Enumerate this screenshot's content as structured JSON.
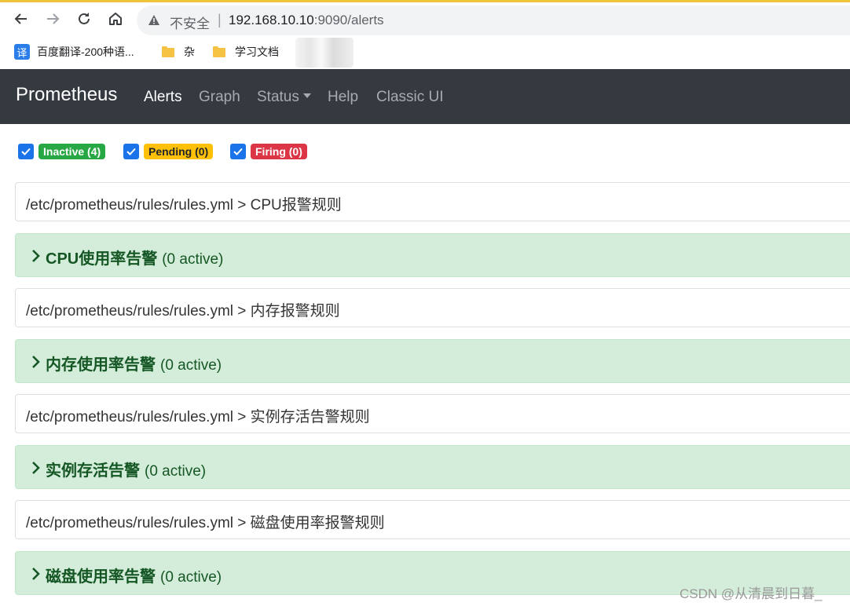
{
  "browser": {
    "insecure_label": "不安全",
    "separator": "|",
    "url_host": "192.168.10.10",
    "url_rest": ":9090/alerts",
    "bookmarks": [
      {
        "label": "百度翻译-200种语...",
        "icon": "translate-icon",
        "icon_text": "译"
      },
      {
        "label": "杂",
        "icon": "folder-icon"
      },
      {
        "label": "学习文档",
        "icon": "folder-icon"
      }
    ]
  },
  "navbar": {
    "brand": "Prometheus",
    "items": [
      {
        "label": "Alerts",
        "active": true
      },
      {
        "label": "Graph"
      },
      {
        "label": "Status"
      },
      {
        "label": "Help"
      },
      {
        "label": "Classic UI"
      }
    ]
  },
  "filters": [
    {
      "label": "Inactive (4)",
      "checked": true,
      "color": "#28a745"
    },
    {
      "label": "Pending (0)",
      "checked": true,
      "color": "#ffc107"
    },
    {
      "label": "Firing (0)",
      "checked": true,
      "color": "#dc3545"
    }
  ],
  "rule_groups": [
    {
      "file": "/etc/prometheus/rules/rules.yml > CPU报警规则",
      "name": "CPU使用率告警",
      "count": "(0 active)"
    },
    {
      "file": "/etc/prometheus/rules/rules.yml > 内存报警规则",
      "name": "内存使用率告警",
      "count": "(0 active)"
    },
    {
      "file": "/etc/prometheus/rules/rules.yml > 实例存活告警规则",
      "name": "实例存活告警",
      "count": "(0 active)"
    },
    {
      "file": "/etc/prometheus/rules/rules.yml > 磁盘使用率报警规则",
      "name": "磁盘使用率告警",
      "count": "(0 active)"
    }
  ],
  "watermark": "CSDN @从清晨到日暮_"
}
